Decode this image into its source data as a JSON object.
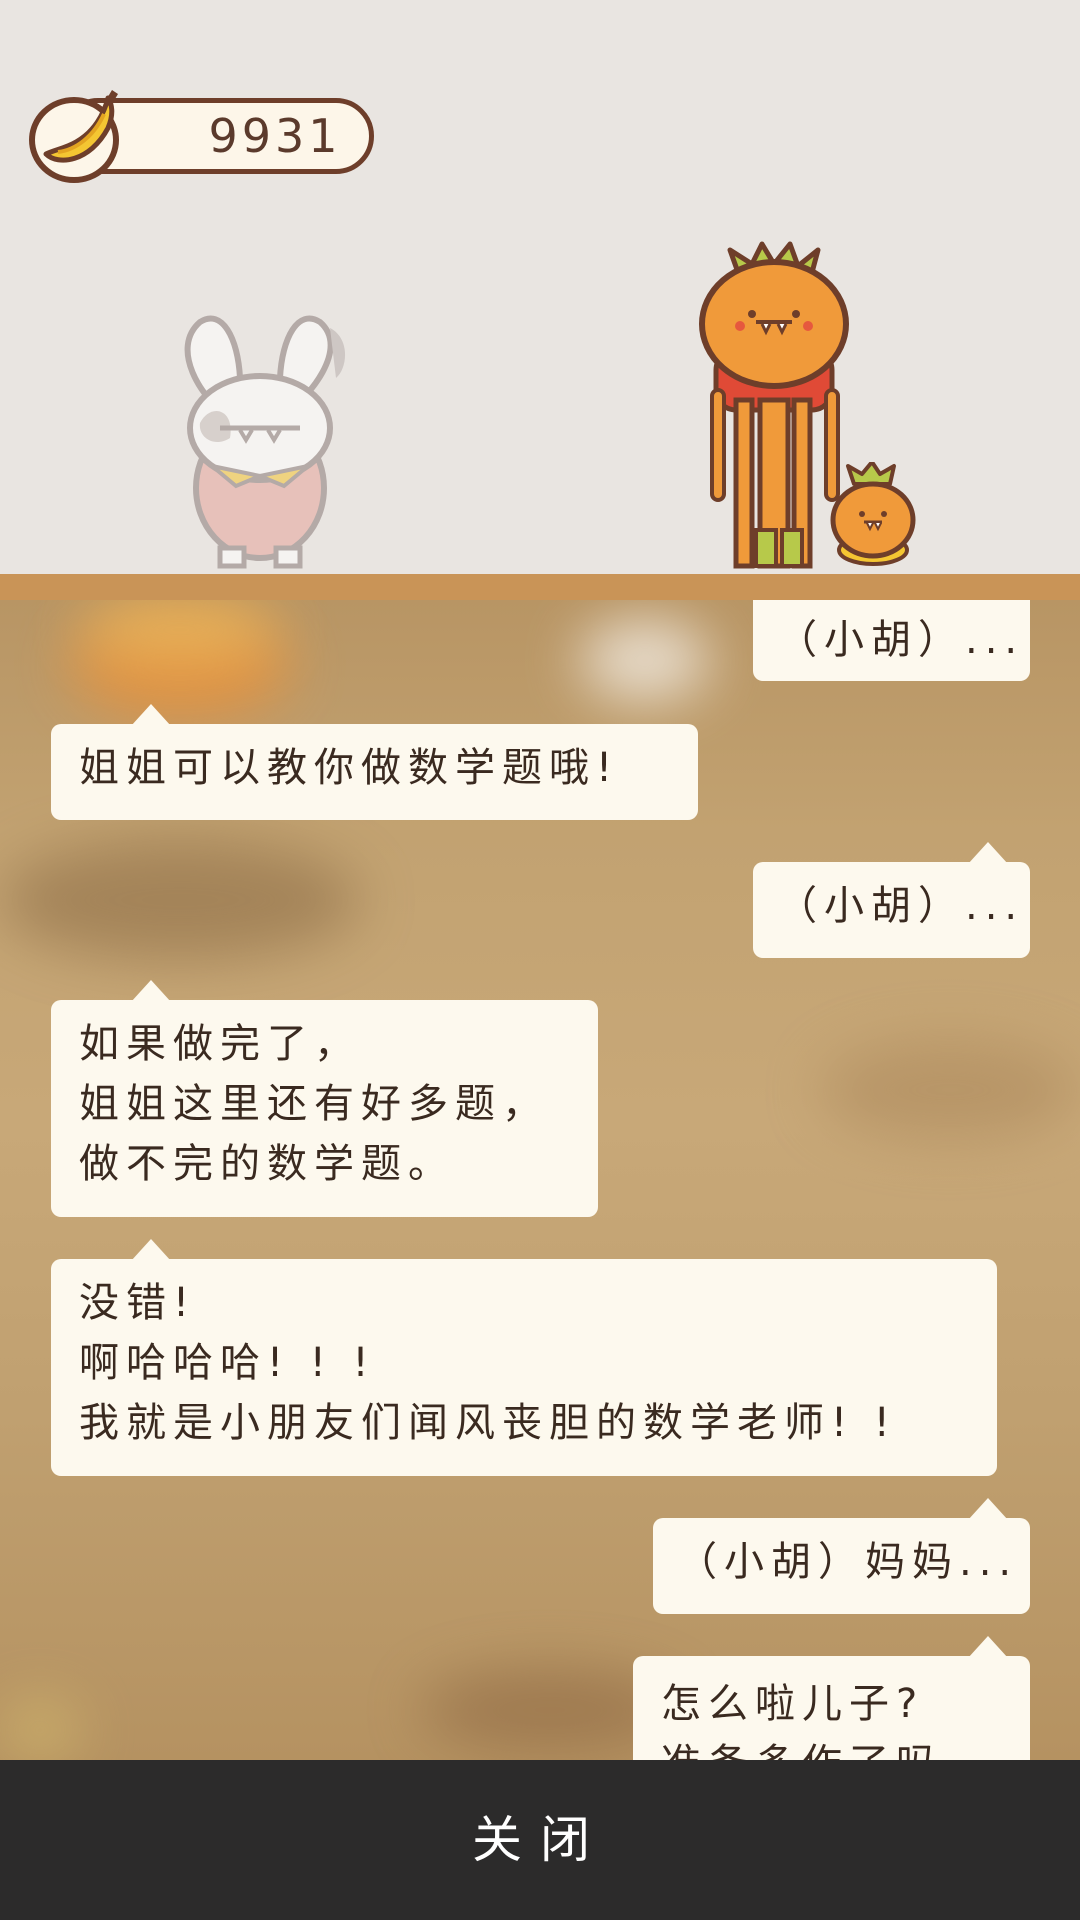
{
  "hud": {
    "banana_count": "9931"
  },
  "dialogue": [
    {
      "speaker": "boy",
      "side": "right",
      "lines": [
        "（小胡）..."
      ]
    },
    {
      "speaker": "teacher",
      "side": "left",
      "lines": [
        "姐姐可以教你做数学题哦!"
      ]
    },
    {
      "speaker": "boy",
      "side": "right",
      "lines": [
        "（小胡）..."
      ]
    },
    {
      "speaker": "teacher",
      "side": "left",
      "lines": [
        "如果做完了，",
        "姐姐这里还有好多题，",
        "做不完的数学题。"
      ]
    },
    {
      "speaker": "teacher",
      "side": "left",
      "lines": [
        "没错!",
        "啊哈哈哈! ! !",
        "我就是小朋友们闻风丧胆的数学老师! !"
      ]
    },
    {
      "speaker": "boy",
      "side": "right",
      "lines": [
        "（小胡）妈妈..."
      ]
    },
    {
      "speaker": "mother",
      "side": "right",
      "lines": [
        "怎么啦儿子?",
        "准备多作了吗"
      ]
    }
  ],
  "footer": {
    "close_label": "关闭"
  },
  "colors": {
    "bubble": "#fdf9ee",
    "floor": "#c99457",
    "footer": "#2c2b2b",
    "text": "#3a2a20"
  }
}
